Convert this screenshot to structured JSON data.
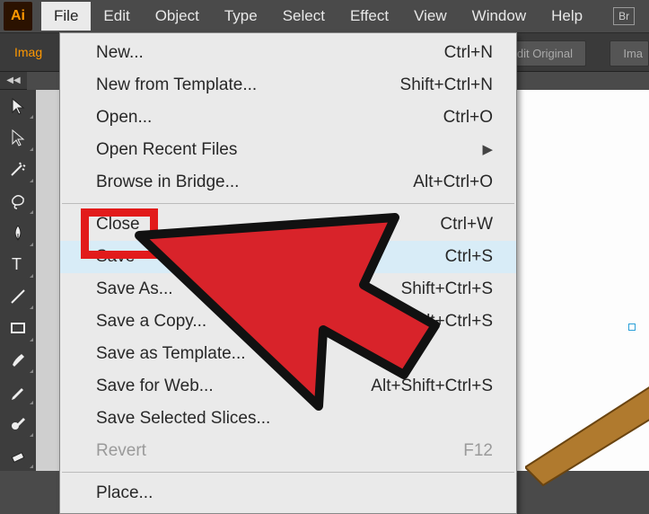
{
  "app_icon": "Ai",
  "menubar": {
    "items": [
      "File",
      "Edit",
      "Object",
      "Type",
      "Select",
      "Effect",
      "View",
      "Window",
      "Help"
    ],
    "open_index": 0,
    "right_box": "Br"
  },
  "controlbar": {
    "left_label": "Imag",
    "edit_original": "Edit Original",
    "right_partial": "Ima"
  },
  "collapse_glyph": "◀◀",
  "dropdown": {
    "groups": [
      [
        {
          "label": "New...",
          "shortcut": "Ctrl+N"
        },
        {
          "label": "New from Template...",
          "shortcut": "Shift+Ctrl+N"
        },
        {
          "label": "Open...",
          "shortcut": "Ctrl+O"
        },
        {
          "label": "Open Recent Files",
          "shortcut": "",
          "submenu": true
        },
        {
          "label": "Browse in Bridge...",
          "shortcut": "Alt+Ctrl+O"
        }
      ],
      [
        {
          "label": "Close",
          "shortcut": "Ctrl+W"
        },
        {
          "label": "Save",
          "shortcut": "Ctrl+S",
          "highlight": true
        },
        {
          "label": "Save As...",
          "shortcut": "Shift+Ctrl+S"
        },
        {
          "label": "Save a Copy...",
          "shortcut": "Alt+Ctrl+S"
        },
        {
          "label": "Save as Template..."
        },
        {
          "label": "Save for Web...",
          "shortcut": "Alt+Shift+Ctrl+S"
        },
        {
          "label": "Save Selected Slices..."
        },
        {
          "label": "Revert",
          "shortcut": "F12",
          "disabled": true
        }
      ],
      [
        {
          "label": "Place..."
        }
      ]
    ]
  },
  "tools": [
    "selection",
    "direct-selection",
    "magic-wand",
    "lasso",
    "pen",
    "type",
    "line",
    "rectangle",
    "paintbrush",
    "pencil",
    "blob-brush",
    "eraser"
  ]
}
